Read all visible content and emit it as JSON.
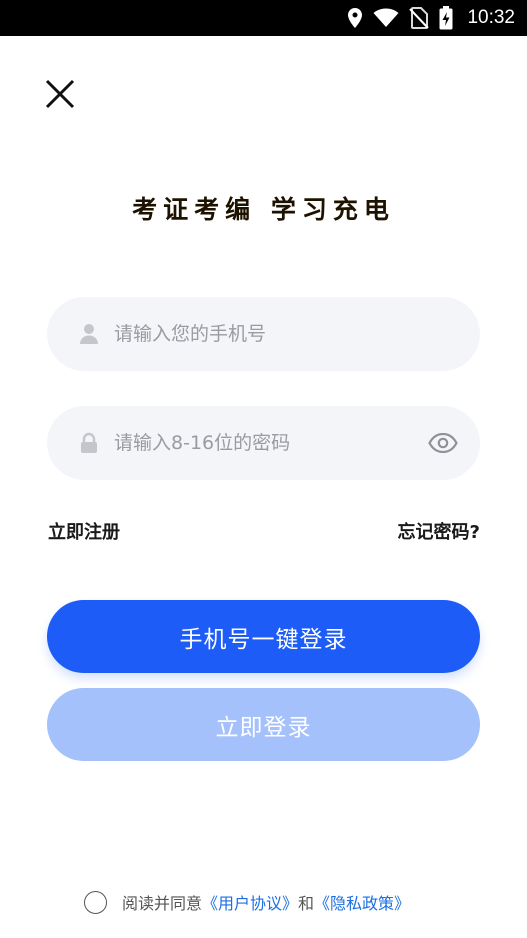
{
  "status_bar": {
    "time": "10:32",
    "icons": [
      "location-icon",
      "wifi-icon",
      "no-sim-icon",
      "battery-charging-icon"
    ]
  },
  "header": {
    "close_icon": "close-icon"
  },
  "slogan": "考证考编 学习充电",
  "form": {
    "phone_placeholder": "请输入您的手机号",
    "phone_value": "",
    "phone_icon": "user-icon",
    "password_placeholder": "请输入8-16位的密码",
    "password_value": "",
    "password_icon": "lock-icon",
    "toggle_icon": "eye-icon"
  },
  "links": {
    "register": "立即注册",
    "forgot": "忘记密码?"
  },
  "buttons": {
    "one_click_login": "手机号一键登录",
    "login": "立即登录"
  },
  "agreement": {
    "prefix": "阅读并同意",
    "user_agreement": "《用户协议》",
    "conjunction": "和",
    "privacy_policy": "《隐私政策》",
    "checked": false
  },
  "colors": {
    "primary": "#1d5cf7",
    "primary_disabled": "#a5c1fb",
    "link": "#1d6fe0",
    "field_bg": "#f4f5f9"
  }
}
